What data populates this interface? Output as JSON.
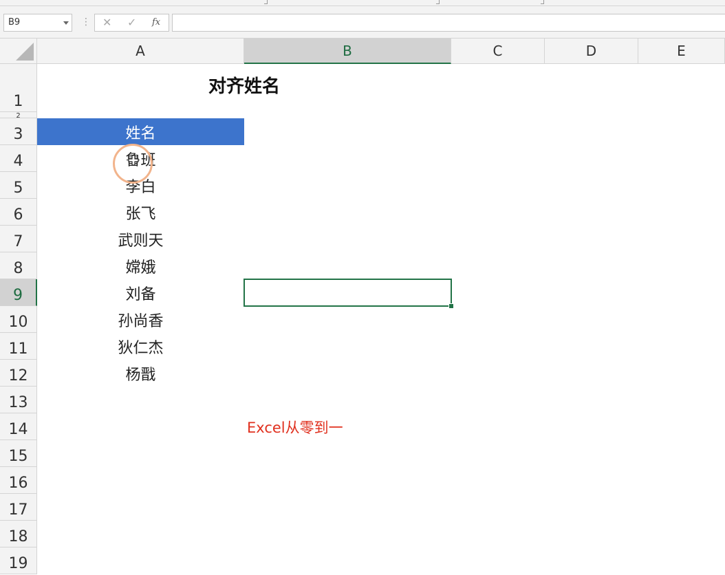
{
  "formula_bar": {
    "name_box": "B9",
    "cancel_glyph": "✕",
    "enter_glyph": "✓",
    "fx_label": "fx",
    "formula_value": ""
  },
  "columns": [
    "A",
    "B",
    "C",
    "D",
    "E"
  ],
  "rows": [
    "1",
    "2",
    "3",
    "4",
    "5",
    "6",
    "7",
    "8",
    "9",
    "10",
    "11",
    "12",
    "13",
    "14",
    "15",
    "16",
    "17",
    "18",
    "19"
  ],
  "sheet": {
    "title": "对齐姓名",
    "header": "姓名",
    "names": [
      "鲁班",
      "李白",
      "张飞",
      "武则天",
      "嫦娥",
      "刘备",
      "孙尚香",
      "狄仁杰",
      "杨戬"
    ],
    "watermark": "Excel从零到一"
  },
  "selection": {
    "cell": "B9"
  },
  "colors": {
    "header_fill": "#3d74cc",
    "selection_border": "#217346",
    "watermark_text": "#e0301e",
    "click_ring": "#f2b48c"
  }
}
